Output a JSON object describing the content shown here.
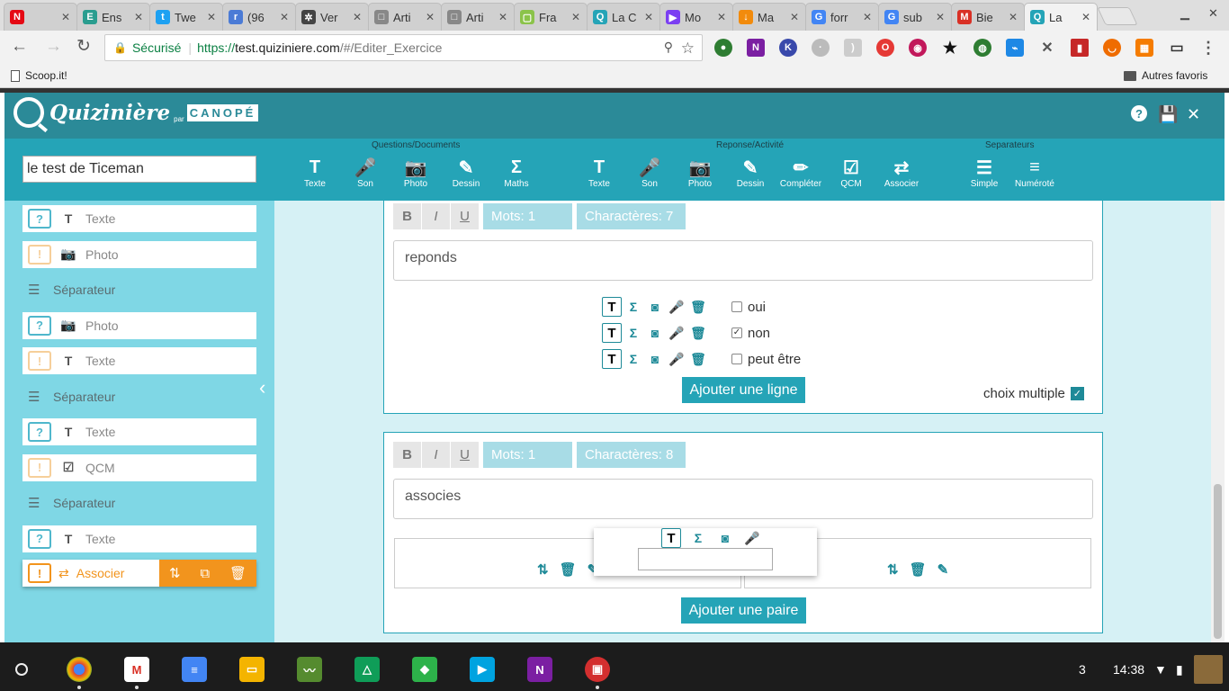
{
  "browser": {
    "tabs": [
      {
        "title": "",
        "favicon": "N",
        "color": "#e50914"
      },
      {
        "title": "Ens",
        "favicon": "E",
        "color": "#2a9d8f"
      },
      {
        "title": "Twe",
        "favicon": "t",
        "color": "#1da1f2"
      },
      {
        "title": "(96",
        "favicon": "r",
        "color": "#4b7bd6"
      },
      {
        "title": "Ver",
        "favicon": "✲",
        "color": "#444444"
      },
      {
        "title": "Arti",
        "favicon": "□",
        "color": "#888888"
      },
      {
        "title": "Arti",
        "favicon": "□",
        "color": "#888888"
      },
      {
        "title": "Fra",
        "favicon": "▢",
        "color": "#8bc34a"
      },
      {
        "title": "La C",
        "favicon": "Q",
        "color": "#25a4b7"
      },
      {
        "title": "Mo",
        "favicon": "▶",
        "color": "#7b3ff2"
      },
      {
        "title": "Ma",
        "favicon": "↓",
        "color": "#f28b0c"
      },
      {
        "title": "forr",
        "favicon": "G",
        "color": "#4285f4"
      },
      {
        "title": "sub",
        "favicon": "G",
        "color": "#4285f4"
      },
      {
        "title": "Bie",
        "favicon": "M",
        "color": "#d93025"
      },
      {
        "title": "La",
        "favicon": "Q",
        "color": "#25a4b7",
        "active": true
      }
    ],
    "url_secure_label": "Sécurisé",
    "url_https": "https://",
    "url_host": "test.quiziniere.com",
    "url_rest": "/#/Editer_Exercice",
    "bookmarks": {
      "left": "Scoop.it!",
      "right": "Autres favoris"
    }
  },
  "app": {
    "logo_text": "Quizinière",
    "logo_par": "par",
    "logo_canope": "CANOPÉ",
    "exercise_title": "le test de Ticeman",
    "groups": {
      "questions": "Questions/Documents",
      "reponse": "Reponse/Activité",
      "separateurs": "Separateurs"
    },
    "tools_questions": [
      {
        "icon": "T",
        "label": "Texte"
      },
      {
        "icon": "🎤",
        "label": "Son"
      },
      {
        "icon": "📷",
        "label": "Photo"
      },
      {
        "icon": "✎",
        "label": "Dessin"
      },
      {
        "icon": "Σ",
        "label": "Maths"
      }
    ],
    "tools_reponse": [
      {
        "icon": "T",
        "label": "Texte"
      },
      {
        "icon": "🎤",
        "label": "Son"
      },
      {
        "icon": "📷",
        "label": "Photo"
      },
      {
        "icon": "✎",
        "label": "Dessin"
      },
      {
        "icon": "✏",
        "label": "Compléter"
      },
      {
        "icon": "☑",
        "label": "QCM"
      },
      {
        "icon": "⇄",
        "label": "Associer"
      }
    ],
    "tools_separateurs": [
      {
        "icon": "☰",
        "label": "Simple"
      },
      {
        "icon": "≡",
        "label": "Numéroté"
      }
    ]
  },
  "sidebar": {
    "items": [
      {
        "kind": "q",
        "type_icon": "T",
        "label": "Texte"
      },
      {
        "kind": "r",
        "type_icon": "📷",
        "label": "Photo"
      },
      {
        "kind": "sep",
        "type_icon": "☰",
        "label": "Séparateur"
      },
      {
        "kind": "q",
        "type_icon": "📷",
        "label": "Photo"
      },
      {
        "kind": "r",
        "type_icon": "T",
        "label": "Texte"
      },
      {
        "kind": "sep",
        "type_icon": "☰",
        "label": "Séparateur"
      },
      {
        "kind": "q",
        "type_icon": "T",
        "label": "Texte"
      },
      {
        "kind": "r",
        "type_icon": "☑",
        "label": "QCM"
      },
      {
        "kind": "sep",
        "type_icon": "☰",
        "label": "Séparateur"
      },
      {
        "kind": "q",
        "type_icon": "T",
        "label": "Texte"
      }
    ],
    "active_item": {
      "type_icon": "⇄",
      "label": "Associer"
    }
  },
  "card1": {
    "words": "Mots: 1",
    "chars": "Charactères: 7",
    "text": "reponds",
    "options": [
      {
        "label": "oui",
        "checked": false
      },
      {
        "label": "non",
        "checked": true
      },
      {
        "label": "peut être",
        "checked": false
      }
    ],
    "add_line": "Ajouter une ligne",
    "multi_choice": "choix multiple"
  },
  "card2": {
    "words": "Mots: 1",
    "chars": "Charactères: 8",
    "text": "associes",
    "add_pair": "Ajouter une paire"
  },
  "system": {
    "notif_count": "3",
    "time": "14:38"
  }
}
